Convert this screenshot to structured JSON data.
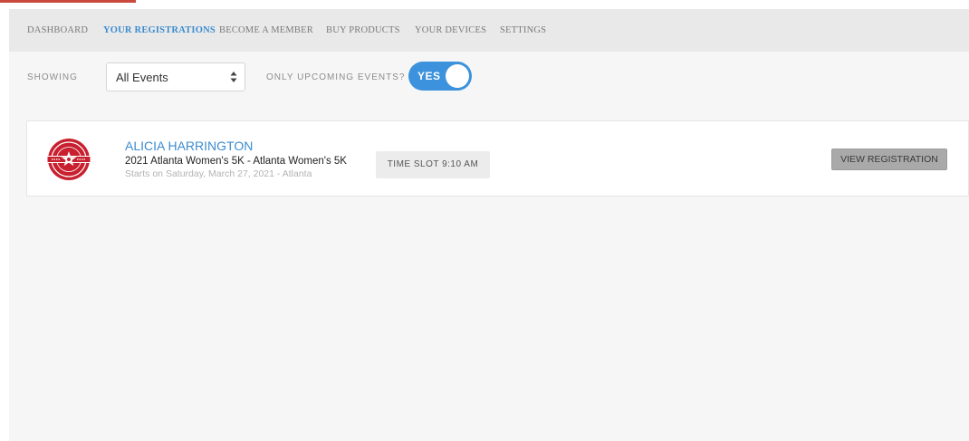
{
  "nav": {
    "items": [
      {
        "label": "DASHBOARD",
        "active": false
      },
      {
        "label": "YOUR REGISTRATIONS",
        "active": true
      },
      {
        "label": "BECOME A MEMBER",
        "active": false
      },
      {
        "label": "BUY PRODUCTS",
        "active": false
      },
      {
        "label": "YOUR DEVICES",
        "active": false
      },
      {
        "label": "SETTINGS",
        "active": false
      }
    ]
  },
  "filters": {
    "showing_label": "SHOWING",
    "showing_value": "All Events",
    "upcoming_label": "ONLY UPCOMING EVENTS?",
    "upcoming_toggle": "YES"
  },
  "registrations": [
    {
      "name": "ALICIA HARRINGTON",
      "event": "2021 Atlanta Women's 5K - Atlanta Women's 5K",
      "starts": "Starts on Saturday, March 27, 2021 - Atlanta",
      "time_slot": "TIME SLOT 9:10 AM",
      "action_label": "VIEW REGISTRATION",
      "logo_icon": "event-logo-icon"
    }
  ],
  "colors": {
    "accent": "#3c8ccf",
    "toggle_on": "#3c92dc",
    "top_accent": "#c94a3c",
    "logo_red": "#c8202f"
  }
}
